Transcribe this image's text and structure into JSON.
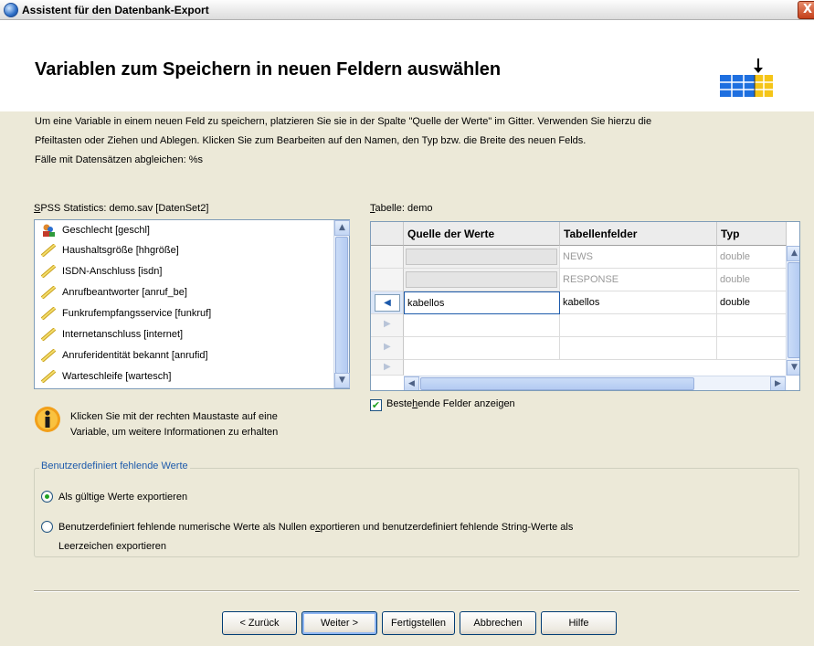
{
  "window": {
    "title": "Assistent für den Datenbank-Export",
    "close_label": "X"
  },
  "header": {
    "title": "Variablen zum Speichern in neuen Feldern auswählen"
  },
  "description": {
    "line1": "Um eine Variable in einem neuen Feld zu speichern, platzieren Sie sie in der Spalte \"Quelle der Werte\" im Gitter. Verwenden Sie hierzu die",
    "line2": "Pfeiltasten oder Ziehen und Ablegen. Klicken Sie zum Bearbeiten auf den Namen, den Typ bzw. die Breite des neuen Felds.",
    "line3": "Fälle mit Datensätzen abgleichen: %s"
  },
  "source": {
    "label_prefix": "S",
    "label_rest": "PSS Statistics:  demo.sav [DatenSet2]",
    "items": [
      {
        "label": "Geschlecht [geschl]",
        "icon": "nominal-icon"
      },
      {
        "label": "Haushaltsgröße [hhgröße]",
        "icon": "scale-icon"
      },
      {
        "label": "ISDN-Anschluss [isdn]",
        "icon": "scale-icon"
      },
      {
        "label": "Anrufbeantworter [anruf_be]",
        "icon": "scale-icon"
      },
      {
        "label": "Funkrufempfangsservice [funkruf]",
        "icon": "scale-icon"
      },
      {
        "label": "Internetanschluss [internet]",
        "icon": "scale-icon"
      },
      {
        "label": "Anruferidentität bekannt [anrufid]",
        "icon": "scale-icon"
      },
      {
        "label": "Warteschleife [wartesch]",
        "icon": "scale-icon"
      }
    ]
  },
  "table": {
    "label_prefix": "T",
    "label_rest": "abelle:  demo",
    "columns": [
      "Quelle der Werte",
      "Tabellenfelder",
      "Typ"
    ],
    "rows": [
      {
        "source": "",
        "field": "NEWS",
        "type": "double"
      },
      {
        "source": "",
        "field": "RESPONSE",
        "type": "double"
      },
      {
        "source": "kabellos",
        "field": "kabellos",
        "type": "double"
      }
    ]
  },
  "show_existing": {
    "label_pre": "Beste",
    "label_ul": "h",
    "label_post": "ende Felder anzeigen",
    "checked": true
  },
  "info": {
    "line1": "Klicken Sie mit der rechten Maustaste auf eine",
    "line2": "Variable, um weitere Informationen zu erhalten"
  },
  "missing": {
    "legend": "Benutzerdefiniert fehlende Werte",
    "option1": {
      "pre": "Als gülti",
      "ul": "g",
      "post": "e Werte exportieren",
      "selected": true
    },
    "option2": {
      "line1_pre": "Benutzerdefiniert fehlende numerische Werte als Nullen e",
      "line1_ul": "x",
      "line1_post": "portieren und benutzerdefiniert fehlende String-Werte als",
      "line2": "Leerzeichen exportieren",
      "selected": false
    }
  },
  "buttons": {
    "back": "< Zurück",
    "next": "Weiter >",
    "finish": "Fertigstellen",
    "cancel": "Abbrechen",
    "help": "Hilfe"
  },
  "colors": {
    "accent": "#1d5aab",
    "check": "#21a121",
    "grid_blue": "#1e6fe0",
    "grid_yellow": "#f5c518"
  }
}
